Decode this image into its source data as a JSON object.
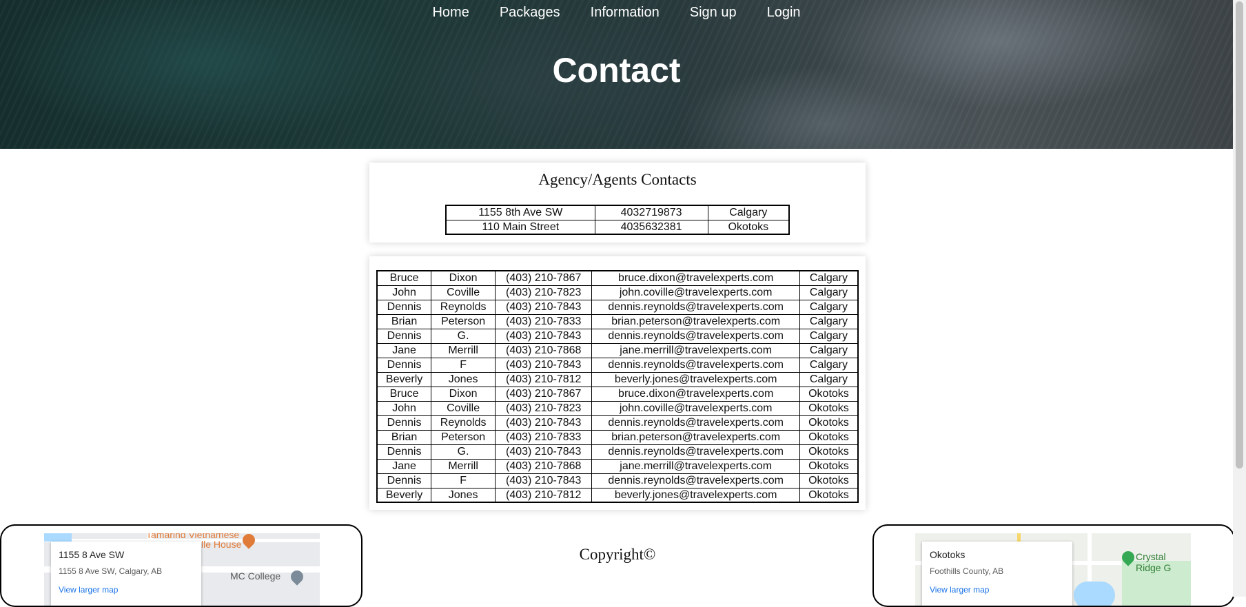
{
  "nav": {
    "items": [
      "Home",
      "Packages",
      "Information",
      "Sign up",
      "Login"
    ]
  },
  "page_title": "Contact",
  "agency_section": {
    "title": "Agency/Agents Contacts",
    "rows": [
      [
        "1155 8th Ave SW",
        "4032719873",
        "Calgary"
      ],
      [
        "110 Main Street",
        "4035632381",
        "Okotoks"
      ]
    ]
  },
  "agents": [
    [
      "Bruce",
      "Dixon",
      "(403) 210-7867",
      "bruce.dixon@travelexperts.com",
      "Calgary"
    ],
    [
      "John",
      "Coville",
      "(403) 210-7823",
      "john.coville@travelexperts.com",
      "Calgary"
    ],
    [
      "Dennis",
      "Reynolds",
      "(403) 210-7843",
      "dennis.reynolds@travelexperts.com",
      "Calgary"
    ],
    [
      "Brian",
      "Peterson",
      "(403) 210-7833",
      "brian.peterson@travelexperts.com",
      "Calgary"
    ],
    [
      "Dennis",
      "G.",
      "(403) 210-7843",
      "dennis.reynolds@travelexperts.com",
      "Calgary"
    ],
    [
      "Jane",
      "Merrill",
      "(403) 210-7868",
      "jane.merrill@travelexperts.com",
      "Calgary"
    ],
    [
      "Dennis",
      "F",
      "(403) 210-7843",
      "dennis.reynolds@travelexperts.com",
      "Calgary"
    ],
    [
      "Beverly",
      "Jones",
      "(403) 210-7812",
      "beverly.jones@travelexperts.com",
      "Calgary"
    ],
    [
      "Bruce",
      "Dixon",
      "(403) 210-7867",
      "bruce.dixon@travelexperts.com",
      "Okotoks"
    ],
    [
      "John",
      "Coville",
      "(403) 210-7823",
      "john.coville@travelexperts.com",
      "Okotoks"
    ],
    [
      "Dennis",
      "Reynolds",
      "(403) 210-7843",
      "dennis.reynolds@travelexperts.com",
      "Okotoks"
    ],
    [
      "Brian",
      "Peterson",
      "(403) 210-7833",
      "brian.peterson@travelexperts.com",
      "Okotoks"
    ],
    [
      "Dennis",
      "G.",
      "(403) 210-7843",
      "dennis.reynolds@travelexperts.com",
      "Okotoks"
    ],
    [
      "Jane",
      "Merrill",
      "(403) 210-7868",
      "jane.merrill@travelexperts.com",
      "Okotoks"
    ],
    [
      "Dennis",
      "F",
      "(403) 210-7843",
      "dennis.reynolds@travelexperts.com",
      "Okotoks"
    ],
    [
      "Beverly",
      "Jones",
      "(403) 210-7812",
      "beverly.jones@travelexperts.com",
      "Okotoks"
    ]
  ],
  "maps": {
    "left": {
      "title": "1155 8 Ave SW",
      "address": "1155 8 Ave SW, Calgary, AB",
      "link": "View larger map",
      "poi_top": "Tamarind Vietnamese",
      "poi_house": "lle House",
      "poi_college": "MC College"
    },
    "right": {
      "title": "Okotoks",
      "address": "Foothills County, AB",
      "link": "View larger map",
      "poi": "Crystal Ridge G"
    }
  },
  "footer": {
    "copyright": "Copyright©"
  },
  "colors": {
    "link_blue": "#1a73e8",
    "text": "#111111",
    "hero_dark": "#1d3a38"
  }
}
